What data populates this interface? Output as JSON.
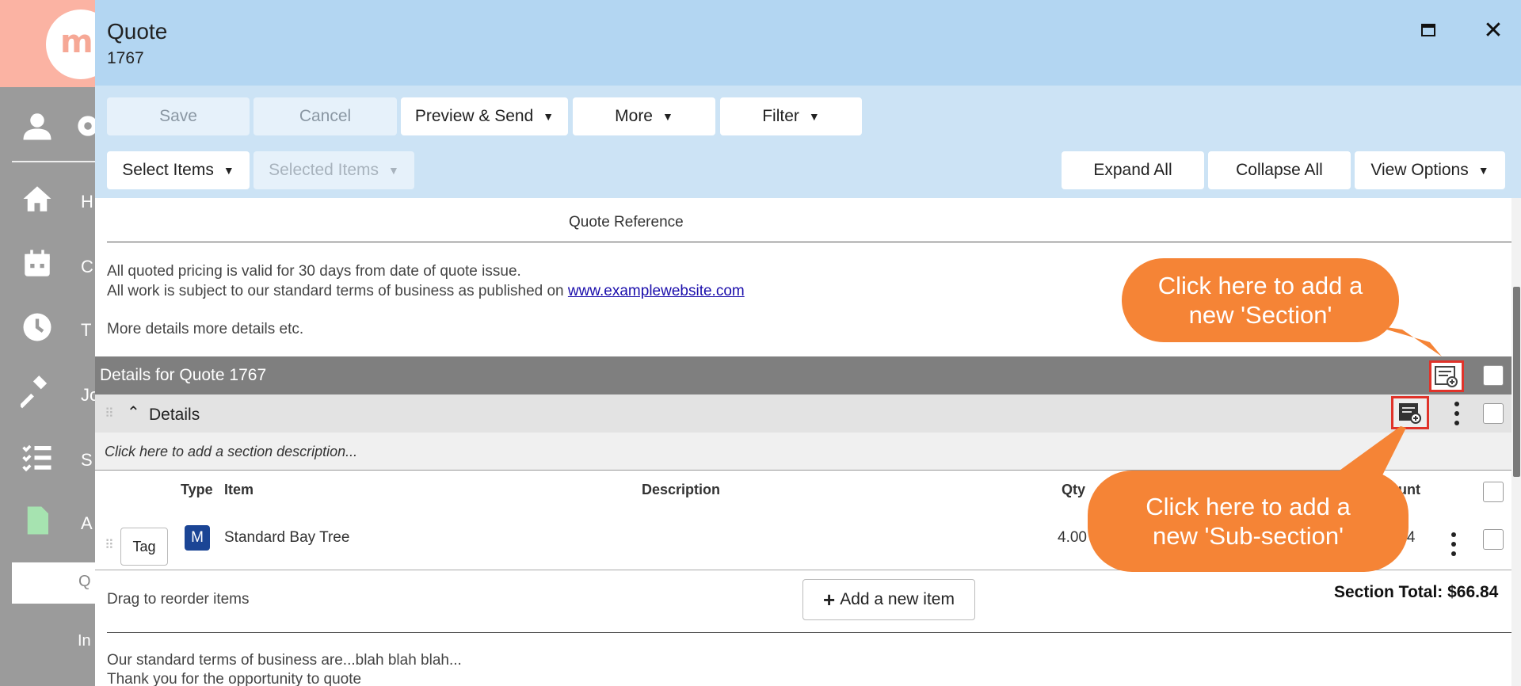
{
  "background": {
    "logo_text": "m",
    "nav_labels": [
      "H",
      "C",
      "T",
      "Jo",
      "S",
      "A"
    ],
    "active_item_label": "Q",
    "next_item_label": "In"
  },
  "modal": {
    "title": "Quote",
    "subtitle": "1767"
  },
  "toolbar": {
    "save": "Save",
    "cancel": "Cancel",
    "preview_send": "Preview & Send",
    "more": "More",
    "filter": "Filter",
    "select_items": "Select Items",
    "selected_items": "Selected Items",
    "expand_all": "Expand All",
    "collapse_all": "Collapse All",
    "view_options": "View Options"
  },
  "content": {
    "quote_reference": "Quote Reference",
    "terms_line1": "All quoted pricing is valid for 30 days from date of quote issue.",
    "terms_line2_prefix": "All work is subject to our standard terms of business as published on ",
    "terms_link": "www.examplewebsite.com",
    "more_details": "More details more details etc.",
    "section_title": "Details for Quote 1767",
    "subsection_title": "Details",
    "section_description_placeholder": "Click here to add a section description...",
    "columns": {
      "type": "Type",
      "item": "Item",
      "description": "Description",
      "qty": "Qty",
      "amount": "ount"
    },
    "rows": [
      {
        "tag": "Tag",
        "badge": "M",
        "item": "Standard Bay Tree",
        "qty": "4.00",
        "amount": ".84"
      }
    ],
    "drag_note": "Drag to reorder items",
    "add_item": "Add a new item",
    "section_total": "Section Total: $66.84",
    "footer_line1": "Our standard terms of business are...blah blah blah...",
    "footer_line2": "Thank you for the opportunity to quote"
  },
  "callouts": {
    "section": "Click here to add a new 'Section'",
    "subsection": "Click here to add a new 'Sub-section'"
  },
  "colors": {
    "header": "#b3d6f2",
    "toolbar": "#cce3f5",
    "callout": "#f58436",
    "highlight": "#e0332a",
    "section_bar": "#7f7f7f"
  }
}
